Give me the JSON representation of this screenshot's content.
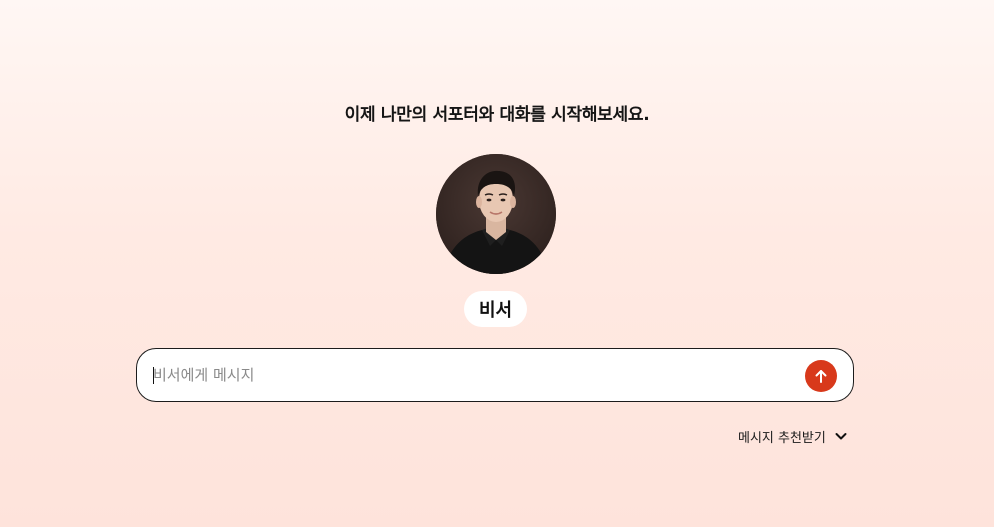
{
  "headline": "이제 나만의 서포터와 대화를 시작해보세요.",
  "assistant": {
    "name": "비서",
    "avatar_alt": "비서"
  },
  "composer": {
    "placeholder": "비서에게 메시지",
    "value": ""
  },
  "send_button": {
    "icon": "arrow-up-icon"
  },
  "suggestions": {
    "label": "메시지 추천받기",
    "icon": "chevron-down-icon"
  },
  "colors": {
    "accent": "#d8391b",
    "background_top": "#fff7f4",
    "background_bottom": "#fee3db"
  }
}
